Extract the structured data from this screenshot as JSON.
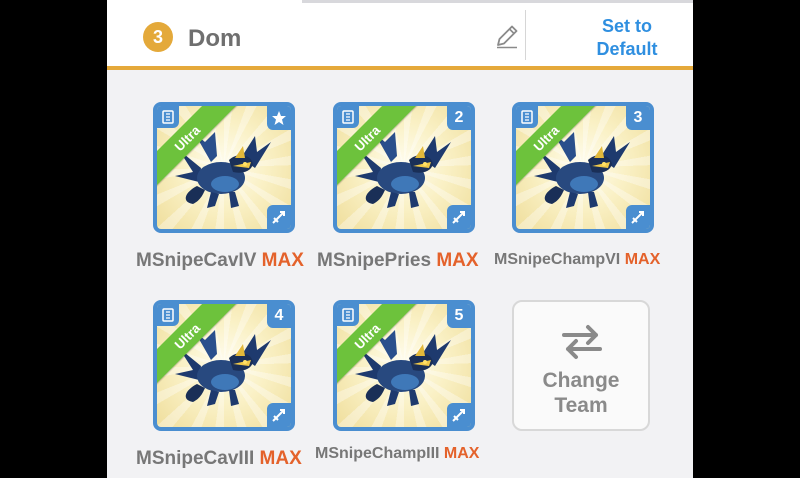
{
  "header": {
    "team_number": "3",
    "team_name": "Dom",
    "set_default_line1": "Set to",
    "set_default_line2": "Default"
  },
  "colors": {
    "accent_gold": "#e4a93a",
    "link_blue": "#2f8fe0",
    "card_border_blue": "#4a8ed0",
    "ultra_green": "#6dc23c",
    "max_orange": "#e4622b"
  },
  "slots": [
    {
      "name": "MSnipeCavIV",
      "level": "MAX",
      "rarity": "Ultra",
      "badge": "star-icon"
    },
    {
      "name": "MSnipePries",
      "level": "MAX",
      "rarity": "Ultra",
      "badge": "2"
    },
    {
      "name": "MSnipeChampVI",
      "level": "MAX",
      "rarity": "Ultra",
      "badge": "3"
    },
    {
      "name": "MSnipeCavIII",
      "level": "MAX",
      "rarity": "Ultra",
      "badge": "4"
    },
    {
      "name": "MSnipeChampIII",
      "level": "MAX",
      "rarity": "Ultra",
      "badge": "5"
    }
  ],
  "change_team": {
    "line1": "Change",
    "line2": "Team"
  }
}
